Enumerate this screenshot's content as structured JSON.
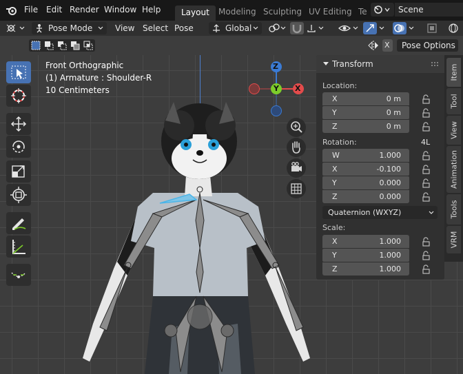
{
  "menubar": {
    "items": [
      "File",
      "Edit",
      "Render",
      "Window",
      "Help"
    ],
    "workspace_tabs": [
      "Layout",
      "Modeling",
      "Sculpting",
      "UV Editing",
      "Te"
    ],
    "scene_label": "Scene"
  },
  "header": {
    "mode": "Pose Mode",
    "menus": [
      "View",
      "Select",
      "Pose"
    ],
    "orientation": "Global"
  },
  "subbar": {
    "x_label": "X",
    "pose_options": "Pose Options"
  },
  "viewport": {
    "view_name": "Front Orthographic",
    "object_info": "(1) Armature : Shoulder-R",
    "scale_info": "10 Centimeters",
    "gizmo": {
      "z": "Z",
      "y": "Y",
      "x": "X"
    }
  },
  "npanel": {
    "header": "Transform",
    "location_label": "Location:",
    "location": [
      {
        "axis": "X",
        "value": "0 m"
      },
      {
        "axis": "Y",
        "value": "0 m"
      },
      {
        "axis": "Z",
        "value": "0 m"
      }
    ],
    "rotation_label": "Rotation:",
    "rotation_mode_tag": "4L",
    "rotation": [
      {
        "axis": "W",
        "value": "1.000"
      },
      {
        "axis": "X",
        "value": "-0.100"
      },
      {
        "axis": "Y",
        "value": "0.000"
      },
      {
        "axis": "Z",
        "value": "0.000"
      }
    ],
    "rotation_mode": "Quaternion (WXYZ)",
    "scale_label": "Scale:",
    "scale": [
      {
        "axis": "X",
        "value": "1.000"
      },
      {
        "axis": "Y",
        "value": "1.000"
      },
      {
        "axis": "Z",
        "value": "1.000"
      }
    ]
  },
  "side_tabs": [
    "Item",
    "Tool",
    "View",
    "Animation",
    "Tools",
    "VRM"
  ],
  "colors": {
    "accent": "#4772b3",
    "x_axis": "#e34b4b",
    "y_axis": "#7ccc2a",
    "z_axis": "#3b7bd4"
  }
}
